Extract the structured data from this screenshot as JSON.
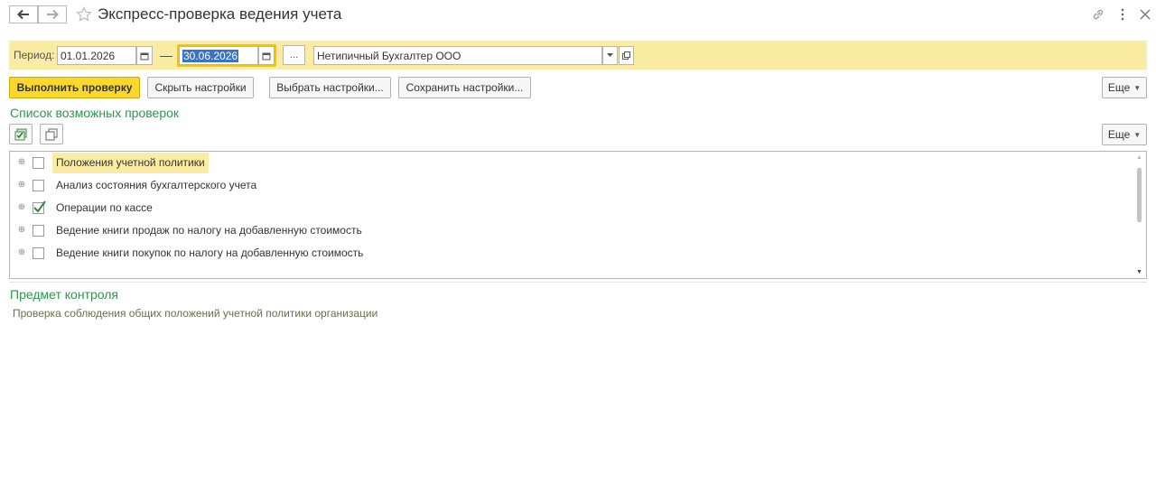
{
  "window": {
    "title": "Экспресс-проверка ведения учета",
    "back_icon": "arrow-left-icon",
    "forward_icon": "arrow-right-icon",
    "favorite_icon": "star-icon"
  },
  "period": {
    "label": "Период:",
    "date_from": "01.01.2026",
    "separator": "—",
    "date_to": "30.06.2026",
    "ellipsis_label": "...",
    "organization": "Нетипичный Бухгалтер ООО"
  },
  "toolbar": {
    "run_label": "Выполнить проверку",
    "hide_settings_label": "Скрыть настройки",
    "choose_settings_label": "Выбрать настройки...",
    "save_settings_label": "Сохранить настройки...",
    "more_label": "Еще"
  },
  "checks": {
    "title": "Список возможных проверок",
    "more_label": "Еще",
    "items": [
      {
        "label": "Положения учетной политики",
        "checked": false,
        "selected": true
      },
      {
        "label": "Анализ состояния бухгалтерского учета",
        "checked": false,
        "selected": false
      },
      {
        "label": "Операции по кассе",
        "checked": true,
        "selected": false
      },
      {
        "label": "Ведение книги продаж по налогу на добавленную стоимость",
        "checked": false,
        "selected": false
      },
      {
        "label": "Ведение книги покупок по налогу на добавленную стоимость",
        "checked": false,
        "selected": false
      }
    ]
  },
  "subject": {
    "title": "Предмет контроля",
    "description": "Проверка соблюдения общих положений учетной политики организации"
  },
  "colors": {
    "accent_yellow": "#fbd82d",
    "highlight": "#fbeca4",
    "section_green": "#2a9a4a"
  }
}
